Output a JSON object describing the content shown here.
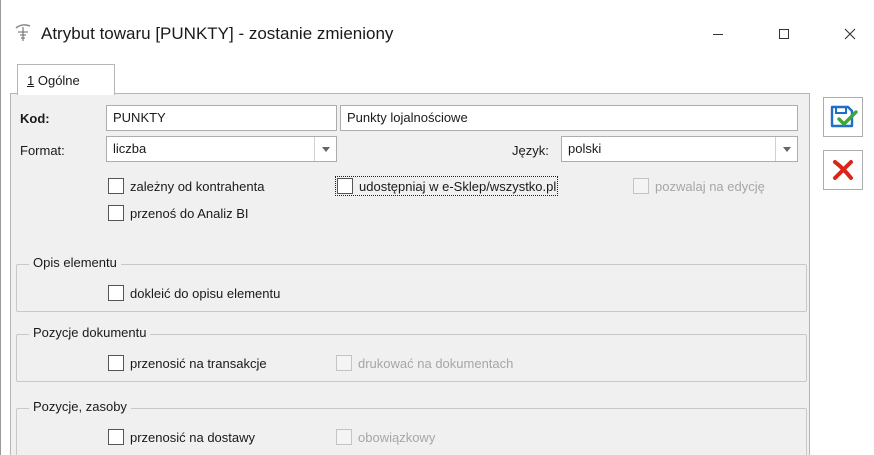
{
  "window": {
    "title": "Atrybut towaru [PUNKTY] - zostanie zmieniony",
    "icon": "attribute-app-icon",
    "controls": {
      "minimize": "minimize-icon",
      "maximize": "maximize-icon",
      "close": "close-icon"
    }
  },
  "tabs": [
    {
      "mnemonic": "1",
      "label": " Ogólne",
      "active": true
    }
  ],
  "form": {
    "kod_label": "Kod:",
    "kod_value": "PUNKTY",
    "name_value": "Punkty lojalnościowe",
    "format_label": "Format:",
    "format_value": "liczba",
    "jezyk_label": "Język:",
    "jezyk_value": "polski"
  },
  "checkboxes": {
    "zalezny": {
      "label": "zależny od kontrahenta",
      "checked": false,
      "enabled": true
    },
    "udostepniaj": {
      "label": "udostępniaj w e-Sklep/wszystko.pl",
      "checked": false,
      "enabled": true
    },
    "pozwalaj": {
      "label": "pozwalaj na edycję",
      "checked": false,
      "enabled": false
    },
    "przenos_bi": {
      "label": "przenoś do Analiz BI",
      "checked": false,
      "enabled": true
    }
  },
  "groups": {
    "opis": {
      "title": "Opis elementu",
      "dokleic": {
        "label": "dokleić do opisu elementu",
        "checked": false,
        "enabled": true
      }
    },
    "pozycje_dok": {
      "title": "Pozycje dokumentu",
      "transakcje": {
        "label": "przenosić na transakcje",
        "checked": false,
        "enabled": true
      },
      "drukowac": {
        "label": "drukować na dokumentach",
        "checked": false,
        "enabled": false
      }
    },
    "pozycje_zasoby": {
      "title": "Pozycje, zasoby",
      "dostawy": {
        "label": "przenosić na dostawy",
        "checked": false,
        "enabled": true
      },
      "obowiazkowy": {
        "label": "obowiązkowy",
        "checked": false,
        "enabled": false
      }
    }
  },
  "side_buttons": {
    "save": {
      "icon": "save-disk-check-icon",
      "color": "#1f6fc5",
      "check_color": "#3aa935"
    },
    "cancel": {
      "icon": "cancel-x-icon",
      "color": "#d9261c"
    }
  },
  "colors": {
    "panel_bg": "#f0f0f0",
    "border": "#adadad",
    "disabled_text": "#a6a6a6"
  }
}
